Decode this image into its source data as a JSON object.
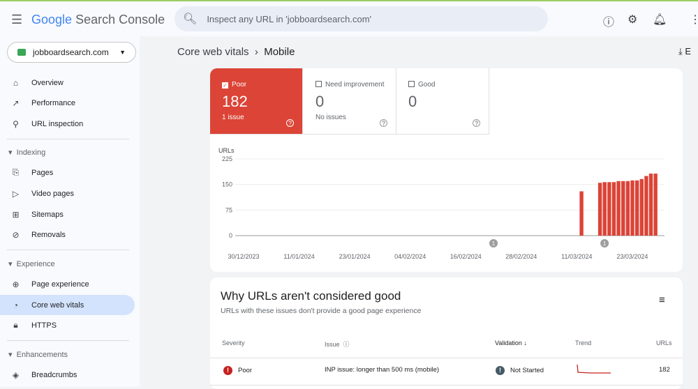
{
  "header": {
    "logo_google": "Google",
    "logo_product": "Search Console",
    "search_placeholder": "Inspect any URL in 'jobboardsearch.com'"
  },
  "property": "jobboardsearch.com",
  "sidebar": {
    "items": [
      {
        "label": "Overview",
        "icon": "home-icon"
      },
      {
        "label": "Performance",
        "icon": "trending-up-icon"
      },
      {
        "label": "URL inspection",
        "icon": "search-icon"
      }
    ],
    "indexing": {
      "title": "Indexing",
      "items": [
        {
          "label": "Pages"
        },
        {
          "label": "Video pages"
        },
        {
          "label": "Sitemaps"
        },
        {
          "label": "Removals"
        }
      ]
    },
    "experience": {
      "title": "Experience",
      "items": [
        {
          "label": "Page experience"
        },
        {
          "label": "Core web vitals"
        },
        {
          "label": "HTTPS"
        }
      ]
    },
    "enhancements": {
      "title": "Enhancements",
      "items": [
        {
          "label": "Breadcrumbs"
        }
      ]
    }
  },
  "breadcrumb": {
    "parent": "Core web vitals",
    "current": "Mobile",
    "export": "E"
  },
  "tiles": [
    {
      "label": "Poor",
      "value": "182",
      "sub": "1 issue",
      "checked": true
    },
    {
      "label": "Need improvement",
      "value": "0",
      "sub": "No issues",
      "checked": false
    },
    {
      "label": "Good",
      "value": "0",
      "sub": "",
      "checked": false
    }
  ],
  "chart_data": {
    "type": "bar",
    "ylabel": "URLs",
    "ylim": [
      0,
      225
    ],
    "yticks": [
      "0",
      "75",
      "150",
      "225"
    ],
    "xticks": [
      "30/12/2023",
      "11/01/2024",
      "23/01/2024",
      "04/02/2024",
      "16/02/2024",
      "28/02/2024",
      "11/03/2024",
      "23/03/2024"
    ],
    "x": [
      "12/03/2024",
      "16/03/2024",
      "17/03/2024",
      "18/03/2024",
      "19/03/2024",
      "20/03/2024",
      "21/03/2024",
      "22/03/2024",
      "23/03/2024",
      "24/03/2024",
      "25/03/2024",
      "26/03/2024",
      "27/03/2024",
      "28/03/2024"
    ],
    "values": [
      130,
      155,
      157,
      157,
      157,
      160,
      160,
      160,
      162,
      162,
      166,
      175,
      182,
      182
    ],
    "annotations": [
      {
        "date": "22/02/2024",
        "label": "1"
      },
      {
        "date": "17/03/2024",
        "label": "1"
      }
    ],
    "color": "#db4437",
    "grid": true
  },
  "issues": {
    "title": "Why URLs aren't considered good",
    "subtitle": "URLs with these issues don't provide a good page experience",
    "headers": {
      "severity": "Severity",
      "issue": "Issue",
      "validation": "Validation",
      "trend": "Trend",
      "urls": "URLs"
    },
    "rows": [
      {
        "severity": "Poor",
        "issue": "INP issue: longer than 500 ms (mobile)",
        "validation": "Not Started",
        "urls": "182"
      }
    ]
  }
}
